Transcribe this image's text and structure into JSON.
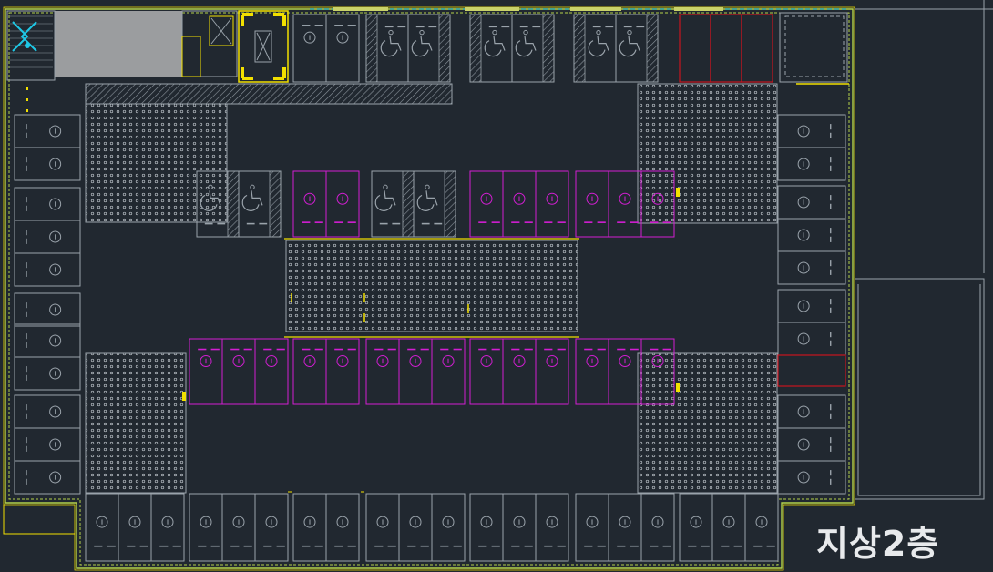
{
  "title": {
    "floor_label": "지상2층"
  },
  "colors": {
    "background": "#212830",
    "outline_gray": "#9aa3ab",
    "wall_green": "#b5d24a",
    "highlight_yellow": "#f2e000",
    "accessible_magenta": "#d21ed2",
    "reserved_red": "#c8141e",
    "fixture_cyan": "#1ec8e6",
    "core_fill": "#9b9d9f"
  },
  "legend": {
    "standard_stall_icon": "parking-stall-icon",
    "accessible_stall_icon": "wheelchair-icon",
    "ev_stall_icon": "ev-charging-icon",
    "landscape_pattern": "dotted-planting-area"
  }
}
